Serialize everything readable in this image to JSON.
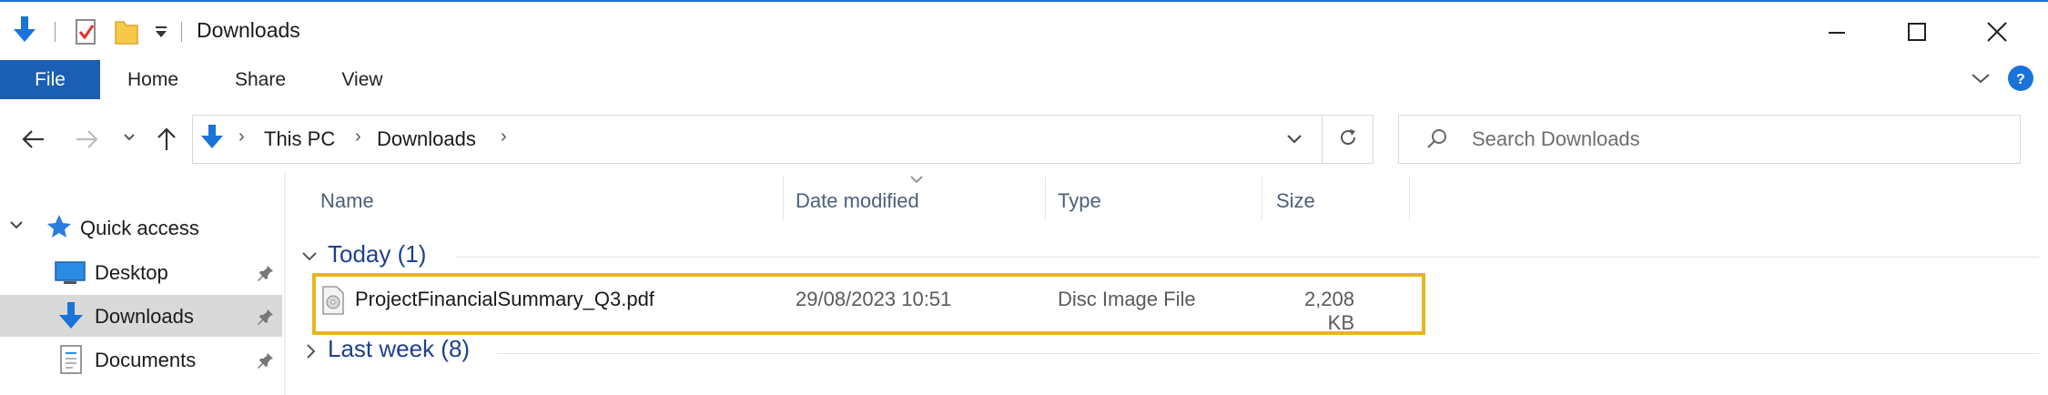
{
  "window": {
    "title": "Downloads",
    "accent_color": "#1a5fb4",
    "controls": [
      "minimize",
      "maximize",
      "close"
    ]
  },
  "ribbon": {
    "tabs": [
      {
        "label": "File",
        "active": true
      },
      {
        "label": "Home"
      },
      {
        "label": "Share"
      },
      {
        "label": "View"
      }
    ]
  },
  "address": {
    "breadcrumbs": [
      "This PC",
      "Downloads"
    ],
    "search_placeholder": "Search Downloads"
  },
  "nav": {
    "quick_access_label": "Quick access",
    "items": [
      {
        "label": "Desktop",
        "icon": "desktop-icon",
        "pinned": true,
        "selected": false
      },
      {
        "label": "Downloads",
        "icon": "download-arrow-icon",
        "pinned": true,
        "selected": true
      },
      {
        "label": "Documents",
        "icon": "document-icon",
        "pinned": true,
        "selected": false
      }
    ]
  },
  "file_list": {
    "columns": [
      "Name",
      "Date modified",
      "Type",
      "Size"
    ],
    "sort_column": "Date modified",
    "groups": [
      {
        "label": "Today (1)",
        "expanded": true,
        "rows": [
          {
            "name": "ProjectFinancialSummary_Q3.pdf",
            "date": "29/08/2023 10:51",
            "type": "Disc Image File",
            "size": "2,208 KB",
            "icon": "disc-image-icon",
            "highlighted": true
          }
        ]
      },
      {
        "label": "Last week (8)",
        "expanded": false,
        "rows": []
      }
    ],
    "highlight_color": "#e6b521"
  }
}
